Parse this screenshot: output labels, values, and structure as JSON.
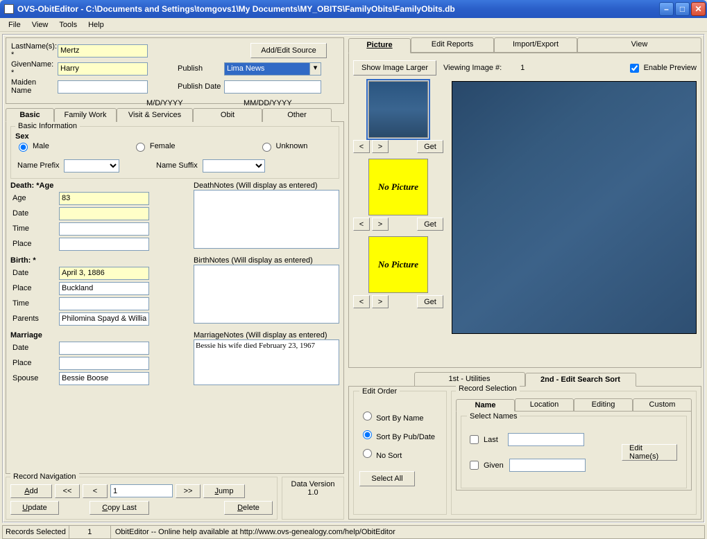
{
  "window": {
    "title": "OVS-ObitEditor  -  C:\\Documents and Settings\\tomgovs1\\My Documents\\MY_OBITS\\FamilyObits\\FamilyObits.db"
  },
  "menu": {
    "file": "File",
    "view": "View",
    "tools": "Tools",
    "help": "Help"
  },
  "top": {
    "lastname_label": "LastName(s): *",
    "lastname": "Mertz",
    "given_label": "GivenName: *",
    "given": "Harry",
    "maiden_label": "Maiden Name",
    "maiden": "",
    "addeditsource": "Add/Edit Source",
    "publish_label": "Publish",
    "publish_value": "Lima News",
    "pubdate_label": "Publish Date",
    "pubdate": "",
    "hint1": "M/D/YYYY",
    "hint2": "MM/DD/YYYY"
  },
  "tabs": {
    "basic": "Basic",
    "family": "Family Work",
    "visit": "Visit & Services",
    "obit": "Obit",
    "other": "Other"
  },
  "basic": {
    "fs_label": "Basic Information",
    "sex_label": "Sex",
    "male": "Male",
    "female": "Female",
    "unknown": "Unknown",
    "sex_value": "male",
    "prefix_label": "Name Prefix",
    "suffix_label": "Name Suffix",
    "death_label": "Death: *Age",
    "age_label": "Age",
    "age": "83",
    "date_label": "Date",
    "time_label": "Time",
    "place_label": "Place",
    "deathnotes_label": "DeathNotes (Will display as entered)",
    "birth_label": "Birth: *",
    "birth_date": "April 3, 1886",
    "birth_place": "Buckland",
    "birth_time": "",
    "birth_parents_label": "Parents",
    "birth_parents": "Philomina Spayd & Willia",
    "birthnotes_label": "BirthNotes (Will display as entered)",
    "marriage_label": "Marriage",
    "spouse_label": "Spouse",
    "spouse": "Bessie Boose",
    "marriagenotes_label": "MarriageNotes (Will display as entered)",
    "marriagenotes": "Bessie his wife died February 23, 1967"
  },
  "recnav": {
    "fs": "Record Navigation",
    "add": "Add",
    "first": "<<",
    "prev": "<",
    "pos": "1",
    "next": ">>",
    "jump": "Jump",
    "update": "Update",
    "copylast": "Copy Last",
    "delete": "Delete",
    "dv_label": "Data Version",
    "dv_val": "1.0"
  },
  "pic": {
    "tabs": {
      "picture": "Picture",
      "reports": "Edit Reports",
      "impexp": "Import/Export",
      "view": "View"
    },
    "show_larger": "Show Image Larger",
    "viewing_label": "Viewing Image #:",
    "viewing_n": "1",
    "enable_preview": "Enable Preview",
    "enable_checked": true,
    "prev": "<",
    "next": ">",
    "get": "Get",
    "nopic": "No Picture"
  },
  "low": {
    "tab1": "1st - Utilities",
    "tab2": "2nd - Edit Search Sort",
    "edit_order": "Edit Order",
    "sort_name": "Sort By Name",
    "sort_pub": "Sort By Pub/Date",
    "no_sort": "No Sort",
    "select_all": "Select All",
    "sort_value": "pub",
    "recsel": "Record Selection",
    "rtab_name": "Name",
    "rtab_loc": "Location",
    "rtab_edit": "Editing",
    "rtab_custom": "Custom",
    "selnames": "Select Names",
    "last": "Last",
    "given": "Given",
    "editnames": "Edit Name(s)"
  },
  "status": {
    "label": "Records Selected",
    "val": "1",
    "msg": "ObitEditor -- Online help available at http://www.ovs-genealogy.com/help/ObitEditor"
  }
}
